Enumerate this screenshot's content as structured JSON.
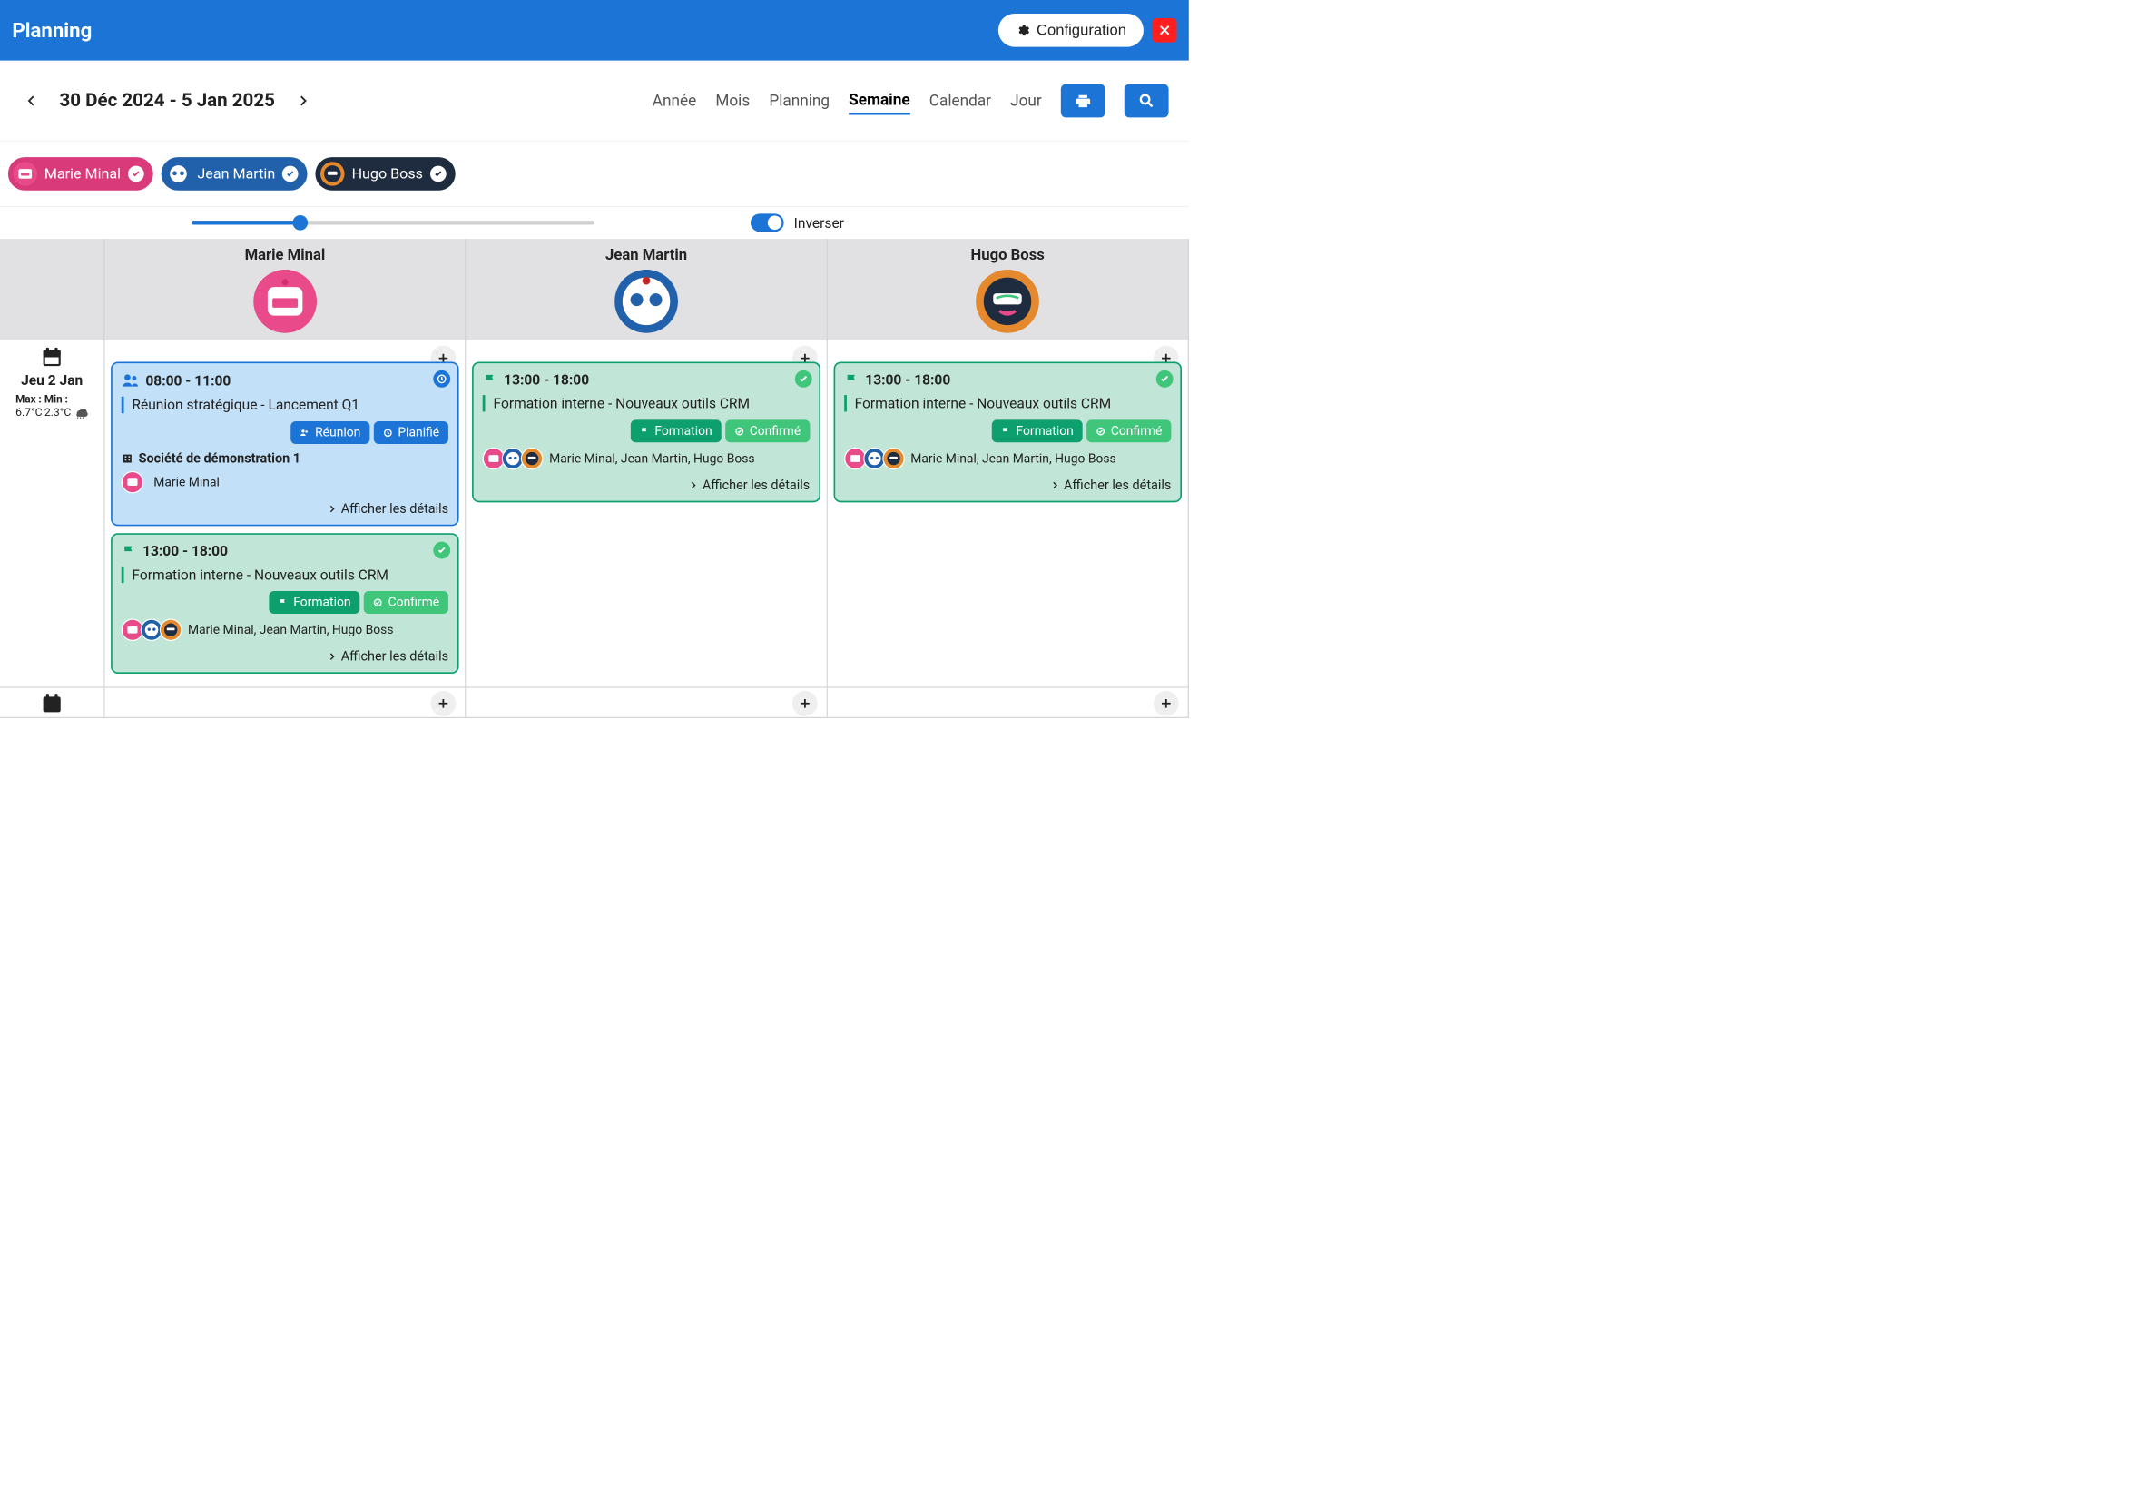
{
  "header": {
    "title": "Planning",
    "config_label": "Configuration"
  },
  "toolbar": {
    "date_range": "30 Déc 2024 - 5 Jan 2025",
    "views": {
      "annee": "Année",
      "mois": "Mois",
      "planning": "Planning",
      "semaine": "Semaine",
      "calendar": "Calendar",
      "jour": "Jour"
    }
  },
  "filters": {
    "marie": "Marie Minal",
    "jean": "Jean Martin",
    "hugo": "Hugo Boss"
  },
  "controls": {
    "toggle_label": "Inverser"
  },
  "columns": {
    "marie": "Marie Minal",
    "jean": "Jean Martin",
    "hugo": "Hugo Boss"
  },
  "day": {
    "label": "Jeu 2 Jan",
    "max_lbl": "Max :",
    "min_lbl": "Min :",
    "max_val": "6.7°C",
    "min_val": "2.3°C"
  },
  "cards": {
    "meeting": {
      "time": "08:00 - 11:00",
      "title": "Réunion stratégique - Lancement Q1",
      "type_label": "Réunion",
      "status_label": "Planifié",
      "company": "Société de démonstration 1",
      "owner": "Marie Minal",
      "details": "Afficher les détails"
    },
    "formation": {
      "time": "13:00 - 18:00",
      "title": "Formation interne - Nouveaux outils CRM",
      "type_label": "Formation",
      "status_label": "Confirmé",
      "attendees": "Marie Minal, Jean Martin, Hugo Boss",
      "details": "Afficher les détails"
    }
  }
}
